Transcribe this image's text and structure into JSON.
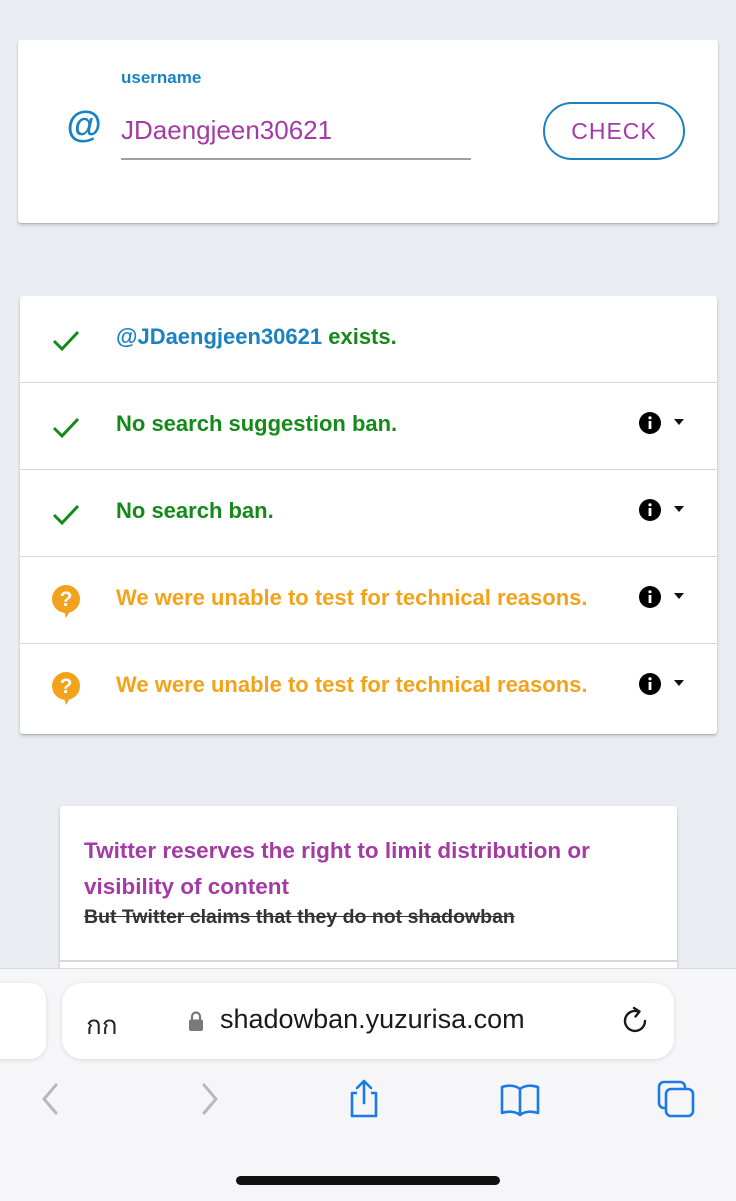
{
  "search": {
    "label": "username",
    "value": "JDaengjeen30621",
    "button": "CHECK",
    "at_symbol": "@"
  },
  "results": {
    "rows": [
      {
        "status": "ok",
        "handle": "@JDaengjeen30621",
        "text": " exists."
      },
      {
        "status": "ok",
        "text": "No search suggestion ban."
      },
      {
        "status": "ok",
        "text": "No search ban."
      },
      {
        "status": "warn",
        "text": "We were unable to test for technical reasons."
      },
      {
        "status": "warn",
        "text": "We were unable to test for technical reasons."
      }
    ]
  },
  "notice": {
    "title": "Twitter reserves the right to limit distribution or visibility of content",
    "strike": "But Twitter claims that they do not shadowban"
  },
  "browser": {
    "reader_label": "กก",
    "url": "shadowban.yuzurisa.com"
  },
  "colors": {
    "accent_blue": "#1b82c0",
    "accent_purple": "#a43ba4",
    "ok_green": "#138a1a",
    "warn_orange": "#f2a31b",
    "ios_blue": "#1a7ae6"
  },
  "icons": [
    "at-icon",
    "check-icon",
    "question-bubble-icon",
    "info-icon",
    "chevron-down-icon",
    "lock-icon",
    "reload-icon",
    "back-icon",
    "forward-icon",
    "share-icon",
    "bookmarks-icon",
    "tabs-icon"
  ]
}
